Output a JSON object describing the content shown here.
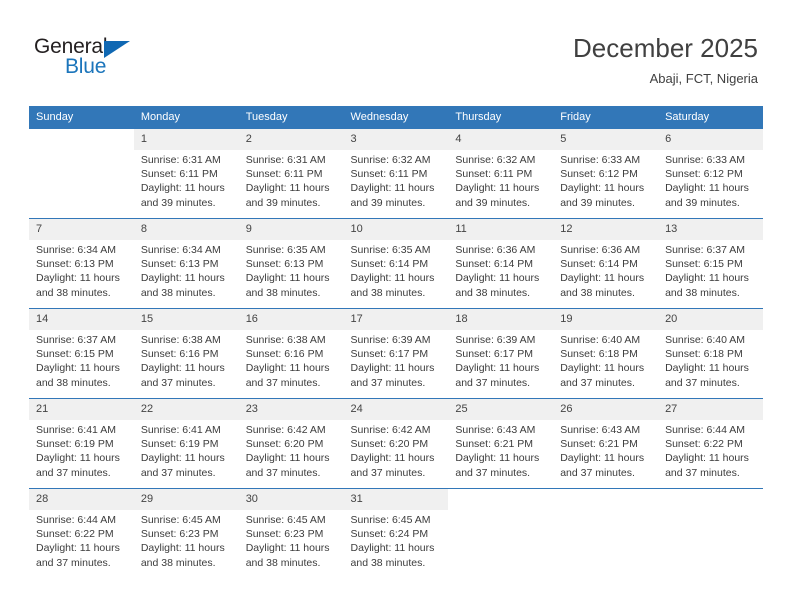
{
  "brand": {
    "name_top": "General",
    "name_bottom": "Blue",
    "triangle_color": "#1068b3",
    "text_color_top": "#231f20",
    "text_color_bottom": "#1b75bb"
  },
  "header": {
    "title": "December 2025",
    "subtitle": "Abaji, FCT, Nigeria"
  },
  "theme": {
    "header_bg": "#3277b8",
    "header_text": "#ffffff",
    "daynum_bg": "#f0f0f0",
    "row_separator": "#3277b8",
    "body_text": "#3c3c3c"
  },
  "calendar": {
    "weekdays": [
      "Sunday",
      "Monday",
      "Tuesday",
      "Wednesday",
      "Thursday",
      "Friday",
      "Saturday"
    ],
    "labels": {
      "sunrise": "Sunrise:",
      "sunset": "Sunset:",
      "daylight": "Daylight:"
    },
    "weeks": [
      [
        {
          "day": "",
          "sunrise": "",
          "sunset": "",
          "daylight_1": "",
          "daylight_2": ""
        },
        {
          "day": "1",
          "sunrise": "Sunrise: 6:31 AM",
          "sunset": "Sunset: 6:11 PM",
          "daylight_1": "Daylight: 11 hours",
          "daylight_2": "and 39 minutes."
        },
        {
          "day": "2",
          "sunrise": "Sunrise: 6:31 AM",
          "sunset": "Sunset: 6:11 PM",
          "daylight_1": "Daylight: 11 hours",
          "daylight_2": "and 39 minutes."
        },
        {
          "day": "3",
          "sunrise": "Sunrise: 6:32 AM",
          "sunset": "Sunset: 6:11 PM",
          "daylight_1": "Daylight: 11 hours",
          "daylight_2": "and 39 minutes."
        },
        {
          "day": "4",
          "sunrise": "Sunrise: 6:32 AM",
          "sunset": "Sunset: 6:11 PM",
          "daylight_1": "Daylight: 11 hours",
          "daylight_2": "and 39 minutes."
        },
        {
          "day": "5",
          "sunrise": "Sunrise: 6:33 AM",
          "sunset": "Sunset: 6:12 PM",
          "daylight_1": "Daylight: 11 hours",
          "daylight_2": "and 39 minutes."
        },
        {
          "day": "6",
          "sunrise": "Sunrise: 6:33 AM",
          "sunset": "Sunset: 6:12 PM",
          "daylight_1": "Daylight: 11 hours",
          "daylight_2": "and 39 minutes."
        }
      ],
      [
        {
          "day": "7",
          "sunrise": "Sunrise: 6:34 AM",
          "sunset": "Sunset: 6:13 PM",
          "daylight_1": "Daylight: 11 hours",
          "daylight_2": "and 38 minutes."
        },
        {
          "day": "8",
          "sunrise": "Sunrise: 6:34 AM",
          "sunset": "Sunset: 6:13 PM",
          "daylight_1": "Daylight: 11 hours",
          "daylight_2": "and 38 minutes."
        },
        {
          "day": "9",
          "sunrise": "Sunrise: 6:35 AM",
          "sunset": "Sunset: 6:13 PM",
          "daylight_1": "Daylight: 11 hours",
          "daylight_2": "and 38 minutes."
        },
        {
          "day": "10",
          "sunrise": "Sunrise: 6:35 AM",
          "sunset": "Sunset: 6:14 PM",
          "daylight_1": "Daylight: 11 hours",
          "daylight_2": "and 38 minutes."
        },
        {
          "day": "11",
          "sunrise": "Sunrise: 6:36 AM",
          "sunset": "Sunset: 6:14 PM",
          "daylight_1": "Daylight: 11 hours",
          "daylight_2": "and 38 minutes."
        },
        {
          "day": "12",
          "sunrise": "Sunrise: 6:36 AM",
          "sunset": "Sunset: 6:14 PM",
          "daylight_1": "Daylight: 11 hours",
          "daylight_2": "and 38 minutes."
        },
        {
          "day": "13",
          "sunrise": "Sunrise: 6:37 AM",
          "sunset": "Sunset: 6:15 PM",
          "daylight_1": "Daylight: 11 hours",
          "daylight_2": "and 38 minutes."
        }
      ],
      [
        {
          "day": "14",
          "sunrise": "Sunrise: 6:37 AM",
          "sunset": "Sunset: 6:15 PM",
          "daylight_1": "Daylight: 11 hours",
          "daylight_2": "and 38 minutes."
        },
        {
          "day": "15",
          "sunrise": "Sunrise: 6:38 AM",
          "sunset": "Sunset: 6:16 PM",
          "daylight_1": "Daylight: 11 hours",
          "daylight_2": "and 37 minutes."
        },
        {
          "day": "16",
          "sunrise": "Sunrise: 6:38 AM",
          "sunset": "Sunset: 6:16 PM",
          "daylight_1": "Daylight: 11 hours",
          "daylight_2": "and 37 minutes."
        },
        {
          "day": "17",
          "sunrise": "Sunrise: 6:39 AM",
          "sunset": "Sunset: 6:17 PM",
          "daylight_1": "Daylight: 11 hours",
          "daylight_2": "and 37 minutes."
        },
        {
          "day": "18",
          "sunrise": "Sunrise: 6:39 AM",
          "sunset": "Sunset: 6:17 PM",
          "daylight_1": "Daylight: 11 hours",
          "daylight_2": "and 37 minutes."
        },
        {
          "day": "19",
          "sunrise": "Sunrise: 6:40 AM",
          "sunset": "Sunset: 6:18 PM",
          "daylight_1": "Daylight: 11 hours",
          "daylight_2": "and 37 minutes."
        },
        {
          "day": "20",
          "sunrise": "Sunrise: 6:40 AM",
          "sunset": "Sunset: 6:18 PM",
          "daylight_1": "Daylight: 11 hours",
          "daylight_2": "and 37 minutes."
        }
      ],
      [
        {
          "day": "21",
          "sunrise": "Sunrise: 6:41 AM",
          "sunset": "Sunset: 6:19 PM",
          "daylight_1": "Daylight: 11 hours",
          "daylight_2": "and 37 minutes."
        },
        {
          "day": "22",
          "sunrise": "Sunrise: 6:41 AM",
          "sunset": "Sunset: 6:19 PM",
          "daylight_1": "Daylight: 11 hours",
          "daylight_2": "and 37 minutes."
        },
        {
          "day": "23",
          "sunrise": "Sunrise: 6:42 AM",
          "sunset": "Sunset: 6:20 PM",
          "daylight_1": "Daylight: 11 hours",
          "daylight_2": "and 37 minutes."
        },
        {
          "day": "24",
          "sunrise": "Sunrise: 6:42 AM",
          "sunset": "Sunset: 6:20 PM",
          "daylight_1": "Daylight: 11 hours",
          "daylight_2": "and 37 minutes."
        },
        {
          "day": "25",
          "sunrise": "Sunrise: 6:43 AM",
          "sunset": "Sunset: 6:21 PM",
          "daylight_1": "Daylight: 11 hours",
          "daylight_2": "and 37 minutes."
        },
        {
          "day": "26",
          "sunrise": "Sunrise: 6:43 AM",
          "sunset": "Sunset: 6:21 PM",
          "daylight_1": "Daylight: 11 hours",
          "daylight_2": "and 37 minutes."
        },
        {
          "day": "27",
          "sunrise": "Sunrise: 6:44 AM",
          "sunset": "Sunset: 6:22 PM",
          "daylight_1": "Daylight: 11 hours",
          "daylight_2": "and 37 minutes."
        }
      ],
      [
        {
          "day": "28",
          "sunrise": "Sunrise: 6:44 AM",
          "sunset": "Sunset: 6:22 PM",
          "daylight_1": "Daylight: 11 hours",
          "daylight_2": "and 37 minutes."
        },
        {
          "day": "29",
          "sunrise": "Sunrise: 6:45 AM",
          "sunset": "Sunset: 6:23 PM",
          "daylight_1": "Daylight: 11 hours",
          "daylight_2": "and 38 minutes."
        },
        {
          "day": "30",
          "sunrise": "Sunrise: 6:45 AM",
          "sunset": "Sunset: 6:23 PM",
          "daylight_1": "Daylight: 11 hours",
          "daylight_2": "and 38 minutes."
        },
        {
          "day": "31",
          "sunrise": "Sunrise: 6:45 AM",
          "sunset": "Sunset: 6:24 PM",
          "daylight_1": "Daylight: 11 hours",
          "daylight_2": "and 38 minutes."
        },
        {
          "day": "",
          "sunrise": "",
          "sunset": "",
          "daylight_1": "",
          "daylight_2": ""
        },
        {
          "day": "",
          "sunrise": "",
          "sunset": "",
          "daylight_1": "",
          "daylight_2": ""
        },
        {
          "day": "",
          "sunrise": "",
          "sunset": "",
          "daylight_1": "",
          "daylight_2": ""
        }
      ]
    ]
  }
}
